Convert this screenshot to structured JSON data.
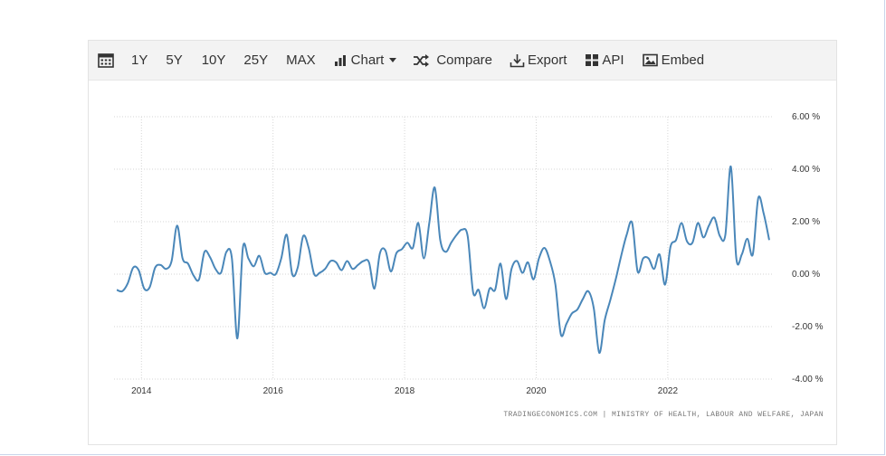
{
  "toolbar": {
    "ranges": [
      "1Y",
      "5Y",
      "10Y",
      "25Y",
      "MAX"
    ],
    "chart_label": "Chart",
    "compare_label": "Compare",
    "export_label": "Export",
    "api_label": "API",
    "embed_label": "Embed"
  },
  "source": "TRADINGECONOMICS.COM | MINISTRY OF HEALTH, LABOUR AND WELFARE, JAPAN",
  "colors": {
    "line": "#4a87b9",
    "grid": "#d6d6d6",
    "toolbar_bg": "#f3f3f3"
  },
  "chart_data": {
    "type": "line",
    "title": "",
    "xlabel": "",
    "ylabel": "",
    "x_ticks": [
      "2014",
      "2016",
      "2018",
      "2020",
      "2022"
    ],
    "y_ticks": [
      "6.00 %",
      "4.00 %",
      "2.00 %",
      "0.00 %",
      "-2.00 %",
      "-4.00 %"
    ],
    "ylim": [
      -4,
      6
    ],
    "xlim": [
      "2013-08",
      "2023-07"
    ],
    "grid": true,
    "series": [
      {
        "values": [
          [
            "2013-08",
            -0.6
          ],
          [
            "2013-09",
            -0.65
          ],
          [
            "2013-10",
            -0.35
          ],
          [
            "2013-11",
            0.25
          ],
          [
            "2013-12",
            0.15
          ],
          [
            "2014-01",
            -0.55
          ],
          [
            "2014-02",
            -0.5
          ],
          [
            "2014-03",
            0.25
          ],
          [
            "2014-04",
            0.35
          ],
          [
            "2014-05",
            0.2
          ],
          [
            "2014-06",
            0.5
          ],
          [
            "2014-07",
            1.85
          ],
          [
            "2014-08",
            0.6
          ],
          [
            "2014-09",
            0.4
          ],
          [
            "2014-10",
            -0.05
          ],
          [
            "2014-11",
            -0.2
          ],
          [
            "2014-12",
            0.85
          ],
          [
            "2015-01",
            0.65
          ],
          [
            "2015-02",
            0.2
          ],
          [
            "2015-03",
            0.05
          ],
          [
            "2015-04",
            0.85
          ],
          [
            "2015-05",
            0.6
          ],
          [
            "2015-06",
            -2.45
          ],
          [
            "2015-07",
            1.0
          ],
          [
            "2015-08",
            0.6
          ],
          [
            "2015-09",
            0.3
          ],
          [
            "2015-10",
            0.7
          ],
          [
            "2015-11",
            0.05
          ],
          [
            "2015-12",
            0.05
          ],
          [
            "2016-01",
            0.0
          ],
          [
            "2016-02",
            0.6
          ],
          [
            "2016-03",
            1.5
          ],
          [
            "2016-04",
            0.0
          ],
          [
            "2016-05",
            0.25
          ],
          [
            "2016-06",
            1.45
          ],
          [
            "2016-07",
            1.0
          ],
          [
            "2016-08",
            0.0
          ],
          [
            "2016-09",
            0.05
          ],
          [
            "2016-10",
            0.2
          ],
          [
            "2016-11",
            0.5
          ],
          [
            "2016-12",
            0.45
          ],
          [
            "2017-01",
            0.15
          ],
          [
            "2017-02",
            0.5
          ],
          [
            "2017-03",
            0.2
          ],
          [
            "2017-04",
            0.35
          ],
          [
            "2017-05",
            0.5
          ],
          [
            "2017-06",
            0.45
          ],
          [
            "2017-07",
            -0.55
          ],
          [
            "2017-08",
            0.8
          ],
          [
            "2017-09",
            0.9
          ],
          [
            "2017-10",
            0.1
          ],
          [
            "2017-11",
            0.8
          ],
          [
            "2017-12",
            0.95
          ],
          [
            "2018-01",
            1.2
          ],
          [
            "2018-02",
            1.0
          ],
          [
            "2018-03",
            1.95
          ],
          [
            "2018-04",
            0.6
          ],
          [
            "2018-05",
            1.95
          ],
          [
            "2018-06",
            3.3
          ],
          [
            "2018-07",
            1.3
          ],
          [
            "2018-08",
            0.85
          ],
          [
            "2018-09",
            1.2
          ],
          [
            "2018-10",
            1.5
          ],
          [
            "2018-11",
            1.7
          ],
          [
            "2018-12",
            1.45
          ],
          [
            "2019-01",
            -0.7
          ],
          [
            "2019-02",
            -0.6
          ],
          [
            "2019-03",
            -1.3
          ],
          [
            "2019-04",
            -0.55
          ],
          [
            "2019-05",
            -0.6
          ],
          [
            "2019-06",
            0.4
          ],
          [
            "2019-07",
            -0.95
          ],
          [
            "2019-08",
            0.2
          ],
          [
            "2019-09",
            0.5
          ],
          [
            "2019-10",
            0.05
          ],
          [
            "2019-11",
            0.45
          ],
          [
            "2019-12",
            -0.2
          ],
          [
            "2020-01",
            0.6
          ],
          [
            "2020-02",
            1.0
          ],
          [
            "2020-03",
            0.5
          ],
          [
            "2020-04",
            -0.4
          ],
          [
            "2020-05",
            -2.3
          ],
          [
            "2020-06",
            -1.9
          ],
          [
            "2020-07",
            -1.5
          ],
          [
            "2020-08",
            -1.35
          ],
          [
            "2020-09",
            -0.95
          ],
          [
            "2020-10",
            -0.65
          ],
          [
            "2020-11",
            -1.3
          ],
          [
            "2020-12",
            -3.0
          ],
          [
            "2021-01",
            -1.75
          ],
          [
            "2021-02",
            -1.0
          ],
          [
            "2021-03",
            -0.2
          ],
          [
            "2021-04",
            0.7
          ],
          [
            "2021-05",
            1.5
          ],
          [
            "2021-06",
            1.95
          ],
          [
            "2021-07",
            0.1
          ],
          [
            "2021-08",
            0.6
          ],
          [
            "2021-09",
            0.6
          ],
          [
            "2021-10",
            0.2
          ],
          [
            "2021-11",
            0.75
          ],
          [
            "2021-12",
            -0.4
          ],
          [
            "2022-01",
            1.05
          ],
          [
            "2022-02",
            1.3
          ],
          [
            "2022-03",
            1.95
          ],
          [
            "2022-04",
            1.25
          ],
          [
            "2022-05",
            1.2
          ],
          [
            "2022-06",
            1.95
          ],
          [
            "2022-07",
            1.4
          ],
          [
            "2022-08",
            1.85
          ],
          [
            "2022-09",
            2.15
          ],
          [
            "2022-10",
            1.45
          ],
          [
            "2022-11",
            1.5
          ],
          [
            "2022-12",
            4.1
          ],
          [
            "2023-01",
            0.6
          ],
          [
            "2023-02",
            0.75
          ],
          [
            "2023-03",
            1.35
          ],
          [
            "2023-04",
            0.75
          ],
          [
            "2023-05",
            2.9
          ],
          [
            "2023-06",
            2.3
          ],
          [
            "2023-07",
            1.3
          ]
        ]
      }
    ]
  }
}
